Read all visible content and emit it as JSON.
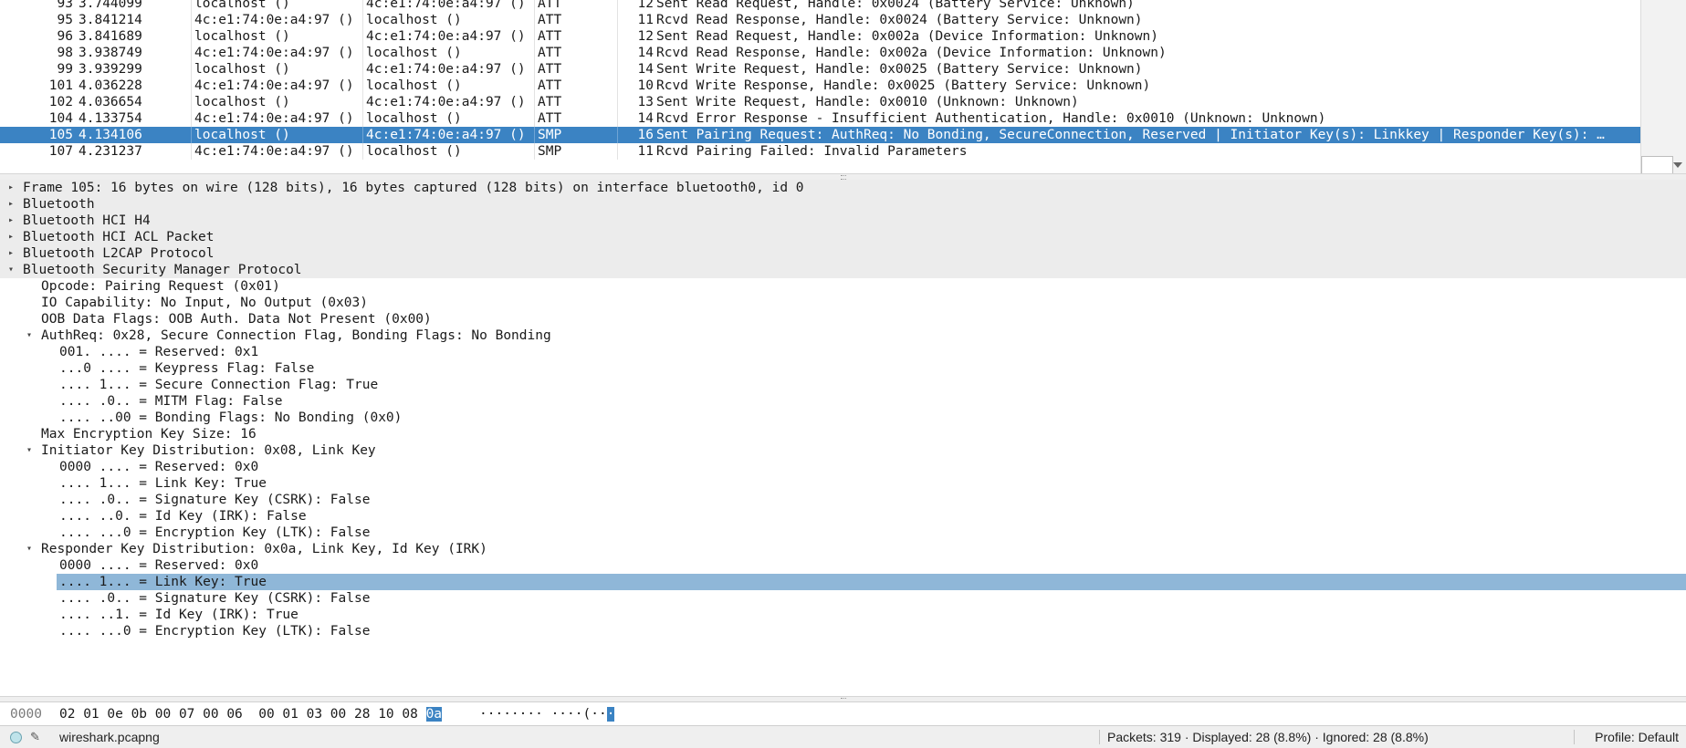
{
  "packet_list": {
    "rows": [
      {
        "no": "93",
        "time": "3.744099",
        "src": "localhost ()",
        "dst": "4c:e1:74:0e:a4:97 ()",
        "proto": "ATT",
        "len": "12",
        "info": "Sent Read Request, Handle: 0x0024 (Battery Service: Unknown)"
      },
      {
        "no": "95",
        "time": "3.841214",
        "src": "4c:e1:74:0e:a4:97 ()",
        "dst": "localhost ()",
        "proto": "ATT",
        "len": "11",
        "info": "Rcvd Read Response, Handle: 0x0024 (Battery Service: Unknown)"
      },
      {
        "no": "96",
        "time": "3.841689",
        "src": "localhost ()",
        "dst": "4c:e1:74:0e:a4:97 ()",
        "proto": "ATT",
        "len": "12",
        "info": "Sent Read Request, Handle: 0x002a (Device Information: Unknown)"
      },
      {
        "no": "98",
        "time": "3.938749",
        "src": "4c:e1:74:0e:a4:97 ()",
        "dst": "localhost ()",
        "proto": "ATT",
        "len": "14",
        "info": "Rcvd Read Response, Handle: 0x002a (Device Information: Unknown)"
      },
      {
        "no": "99",
        "time": "3.939299",
        "src": "localhost ()",
        "dst": "4c:e1:74:0e:a4:97 ()",
        "proto": "ATT",
        "len": "14",
        "info": "Sent Write Request, Handle: 0x0025 (Battery Service: Unknown)"
      },
      {
        "no": "101",
        "time": "4.036228",
        "src": "4c:e1:74:0e:a4:97 ()",
        "dst": "localhost ()",
        "proto": "ATT",
        "len": "10",
        "info": "Rcvd Write Response, Handle: 0x0025 (Battery Service: Unknown)"
      },
      {
        "no": "102",
        "time": "4.036654",
        "src": "localhost ()",
        "dst": "4c:e1:74:0e:a4:97 ()",
        "proto": "ATT",
        "len": "13",
        "info": "Sent Write Request, Handle: 0x0010 (Unknown: Unknown)"
      },
      {
        "no": "104",
        "time": "4.133754",
        "src": "4c:e1:74:0e:a4:97 ()",
        "dst": "localhost ()",
        "proto": "ATT",
        "len": "14",
        "info": "Rcvd Error Response - Insufficient Authentication, Handle: 0x0010 (Unknown: Unknown)"
      },
      {
        "no": "105",
        "time": "4.134106",
        "src": "localhost ()",
        "dst": "4c:e1:74:0e:a4:97 ()",
        "proto": "SMP",
        "len": "16",
        "info": "Sent Pairing Request: AuthReq: No Bonding, SecureConnection, Reserved | Initiator Key(s): Linkkey | Responder Key(s): …"
      },
      {
        "no": "107",
        "time": "4.231237",
        "src": "4c:e1:74:0e:a4:97 ()",
        "dst": "localhost ()",
        "proto": "SMP",
        "len": "11",
        "info": "Rcvd Pairing Failed: Invalid Parameters"
      }
    ],
    "selected_no": "105"
  },
  "details": {
    "frame": "Frame 105: 16 bytes on wire (128 bits), 16 bytes captured (128 bits) on interface bluetooth0, id 0",
    "bluetooth": "Bluetooth",
    "hci_h4": "Bluetooth HCI H4",
    "hci_acl": "Bluetooth HCI ACL Packet",
    "l2cap": "Bluetooth L2CAP Protocol",
    "smp": "Bluetooth Security Manager Protocol",
    "opcode": "Opcode: Pairing Request (0x01)",
    "io_cap": "IO Capability: No Input, No Output (0x03)",
    "oob": "OOB Data Flags: OOB Auth. Data Not Present (0x00)",
    "authreq": "AuthReq: 0x28, Secure Connection Flag, Bonding Flags: No Bonding",
    "authreq_reserved": "001. .... = Reserved: 0x1",
    "authreq_keypress": "...0 .... = Keypress Flag: False",
    "authreq_sc": ".... 1... = Secure Connection Flag: True",
    "authreq_mitm": ".... .0.. = MITM Flag: False",
    "authreq_bonding": ".... ..00 = Bonding Flags: No Bonding (0x0)",
    "max_key": "Max Encryption Key Size: 16",
    "init_key": "Initiator Key Distribution: 0x08, Link Key",
    "init_reserved": "0000 .... = Reserved: 0x0",
    "init_link": ".... 1... = Link Key: True",
    "init_sig": ".... .0.. = Signature Key (CSRK): False",
    "init_id": ".... ..0. = Id Key (IRK): False",
    "init_enc": ".... ...0 = Encryption Key (LTK): False",
    "resp_key": "Responder Key Distribution: 0x0a, Link Key, Id Key (IRK)",
    "resp_reserved": "0000 .... = Reserved: 0x0",
    "resp_link": ".... 1... = Link Key: True",
    "resp_sig": ".... .0.. = Signature Key (CSRK): False",
    "resp_id": ".... ..1. = Id Key (IRK): True",
    "resp_enc": ".... ...0 = Encryption Key (LTK): False"
  },
  "bytes": {
    "offset": "0000",
    "hex_pre": "02 01 0e 0b 00 07 00 06  00 01 03 00 28 10 08 ",
    "hex_sel": "0a",
    "ascii_pre": "········ ····(··",
    "ascii_sel": "·"
  },
  "status": {
    "file": "wireshark.pcapng",
    "packets": "Packets: 319 · Displayed: 28 (8.8%) · Ignored: 28 (8.8%)",
    "profile": "Profile: Default"
  },
  "icons": {
    "expanded": "expanded-arrow-icon",
    "collapsed": "collapsed-arrow-icon",
    "expert": "expert-info-icon",
    "comment": "capture-comment-icon"
  },
  "colors": {
    "selection": "#3b83c3",
    "field_highlight": "#8fb7d8",
    "protocol_row_bg": "#ececec"
  }
}
